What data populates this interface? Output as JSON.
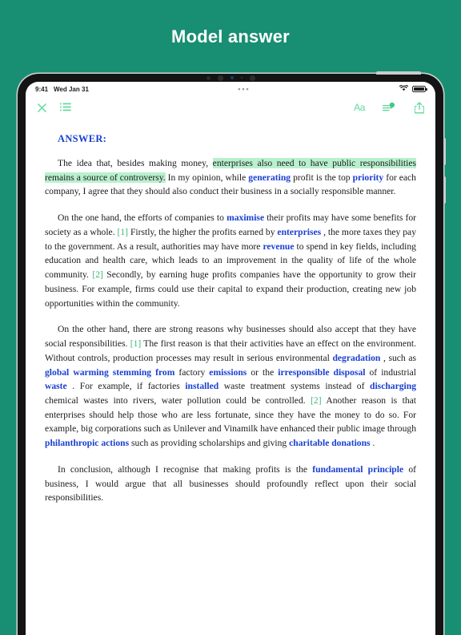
{
  "banner": {
    "title": "Model answer"
  },
  "device": {
    "icons": {
      "sensor_1": "camera-dot",
      "sensor_2": "camera-lens",
      "sensor_3": "sensor-blue-dot",
      "sensor_4": "sensor-micro-dot",
      "sensor_5": "camera-lens-secondary"
    }
  },
  "statusbar": {
    "time": "9:41",
    "date": "Wed Jan 31",
    "center_dots": "•••",
    "wifi_icon": "wifi-icon",
    "battery_icon": "battery-icon"
  },
  "toolbar": {
    "close_icon": "close-x-icon",
    "outline_icon": "list-outline-icon",
    "text_format_label": "Aa",
    "markup_icon": "markup-annotate-icon",
    "share_icon": "share-icon"
  },
  "document": {
    "heading": "ANSWER:",
    "paragraphs": [
      {
        "id": "p1",
        "runs": [
          {
            "t": "The idea that, besides making money, ",
            "s": "plain"
          },
          {
            "t": "enterprises also need to have public responsibilities remains a source of controversy.",
            "s": "highlight"
          },
          {
            "t": " In my opinion, while ",
            "s": "plain"
          },
          {
            "t": "generating",
            "s": "keyword"
          },
          {
            "t": " profit is the top ",
            "s": "plain"
          },
          {
            "t": "priority",
            "s": "keyword"
          },
          {
            "t": " for each company, I agree that they should also conduct their business in a socially responsible manner.",
            "s": "plain"
          }
        ]
      },
      {
        "id": "p2",
        "runs": [
          {
            "t": "On the one hand, the efforts of companies to ",
            "s": "plain"
          },
          {
            "t": "maximise",
            "s": "keyword"
          },
          {
            "t": " their profits may have some benefits for society as a whole. ",
            "s": "plain"
          },
          {
            "t": "[1]",
            "s": "ref"
          },
          {
            "t": " Firstly, the higher the profits earned by ",
            "s": "plain"
          },
          {
            "t": "enterprises",
            "s": "keyword"
          },
          {
            "t": " , the more taxes they pay to the government. As a result, authorities may have more ",
            "s": "plain"
          },
          {
            "t": "revenue",
            "s": "keyword"
          },
          {
            "t": " to spend in key fields, including education and health care, which leads to an improvement in the quality of life of the whole community. ",
            "s": "plain"
          },
          {
            "t": "[2]",
            "s": "ref"
          },
          {
            "t": " Secondly, by earning huge profits companies have the opportunity to grow their business. For example, firms could use their capital to expand their production, creating new job opportunities within the community.",
            "s": "plain"
          }
        ]
      },
      {
        "id": "p3",
        "runs": [
          {
            "t": "On the other hand, there are strong reasons why businesses should also accept that they have social responsibilities. ",
            "s": "plain"
          },
          {
            "t": "[1]",
            "s": "ref"
          },
          {
            "t": " The first reason is that their activities have an effect on the environment. Without controls, production processes may result in serious environmental ",
            "s": "plain"
          },
          {
            "t": "degradation",
            "s": "keyword"
          },
          {
            "t": " , such as ",
            "s": "plain"
          },
          {
            "t": "global warming stemming from",
            "s": "keyword"
          },
          {
            "t": " factory ",
            "s": "plain"
          },
          {
            "t": "emissions",
            "s": "keyword"
          },
          {
            "t": " or the ",
            "s": "plain"
          },
          {
            "t": "irresponsible disposal",
            "s": "keyword"
          },
          {
            "t": " of industrial ",
            "s": "plain"
          },
          {
            "t": "waste",
            "s": "keyword"
          },
          {
            "t": " . For example, if factories ",
            "s": "plain"
          },
          {
            "t": "installed",
            "s": "keyword"
          },
          {
            "t": " waste treatment systems instead of ",
            "s": "plain"
          },
          {
            "t": "discharging",
            "s": "keyword"
          },
          {
            "t": " chemical wastes into rivers, water pollution could be controlled. ",
            "s": "plain"
          },
          {
            "t": "[2]",
            "s": "ref"
          },
          {
            "t": " Another reason is that enterprises should help those who are less fortunate, since they have the money to do so. For example, big corporations such as Unilever and Vinamilk have enhanced their public image through ",
            "s": "plain"
          },
          {
            "t": "philanthropic actions",
            "s": "keyword"
          },
          {
            "t": " such as providing scholarships and giving ",
            "s": "plain"
          },
          {
            "t": "charitable donations",
            "s": "keyword"
          },
          {
            "t": " .",
            "s": "plain"
          }
        ]
      },
      {
        "id": "p4",
        "runs": [
          {
            "t": "In conclusion, although I recognise that making profits is the ",
            "s": "plain"
          },
          {
            "t": "fundamental principle",
            "s": "keyword"
          },
          {
            "t": " of business, I would argue that all businesses should profoundly reflect upon their social responsibilities.",
            "s": "plain"
          }
        ]
      }
    ]
  },
  "colors": {
    "background_teal": "#188e72",
    "keyword_blue": "#1a3fd0",
    "highlight_green": "#b9f0ce",
    "reference_green": "#3bb878",
    "toolbar_icon_green": "#5fd99a"
  }
}
